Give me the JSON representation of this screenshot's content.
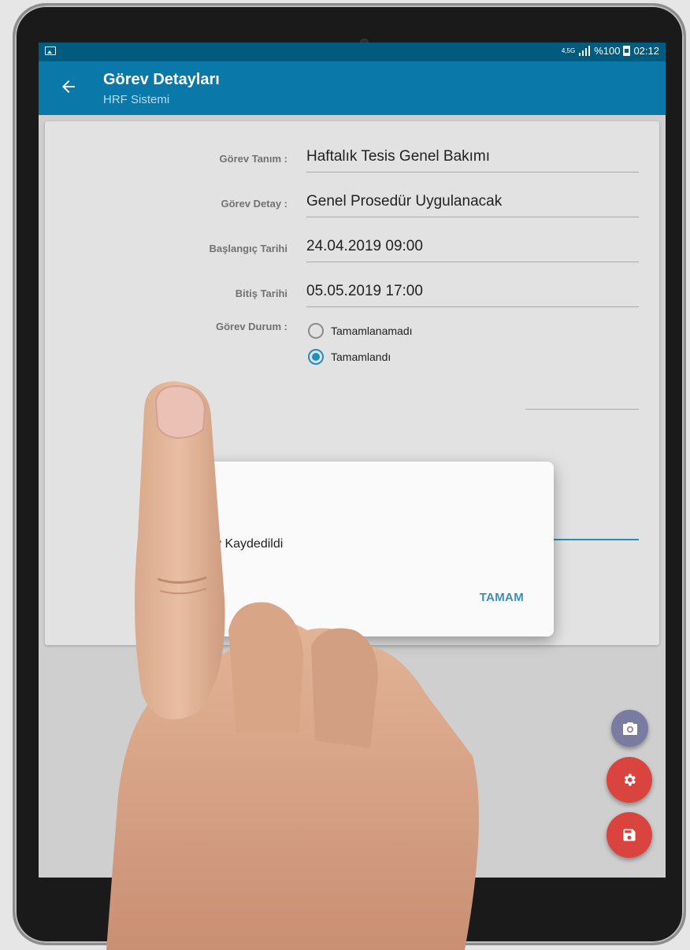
{
  "status_bar": {
    "network": "4,5G",
    "battery_text": "%100",
    "time": "02:12",
    "icons": [
      "image-icon",
      "signal-icon",
      "battery-icon"
    ]
  },
  "app_bar": {
    "title": "Görev Detayları",
    "subtitle": "HRF Sistemi",
    "back_icon": "arrow-left-icon"
  },
  "form": {
    "gorev_tanim": {
      "label": "Görev Tanım :",
      "value": "Haftalık Tesis Genel Bakımı"
    },
    "gorev_detay": {
      "label": "Görev Detay :",
      "value": "Genel Prosedür Uygulanacak"
    },
    "baslangic": {
      "label": "Başlangıç Tarihi",
      "value": "24.04.2019 09:00"
    },
    "bitis": {
      "label": "Bitiş Tarihi",
      "value": "05.05.2019 17:00"
    },
    "durum": {
      "label": "Görev Durum :",
      "options": [
        "Tamamlanamadı",
        "Tamamlandı"
      ],
      "selected": "Tamamlandı"
    }
  },
  "dialog": {
    "message": "v Kaydedildi",
    "ok_label": "TAMAM"
  },
  "fabs": {
    "camera": "camera-icon",
    "settings": "gear-icon",
    "save": "save-icon"
  },
  "colors": {
    "status_bar": "#005b7f",
    "app_bar": "#0a78a8",
    "accent": "#1e8fbf",
    "fab_red": "#d9443e",
    "fab_purple": "#7b7ba2"
  }
}
